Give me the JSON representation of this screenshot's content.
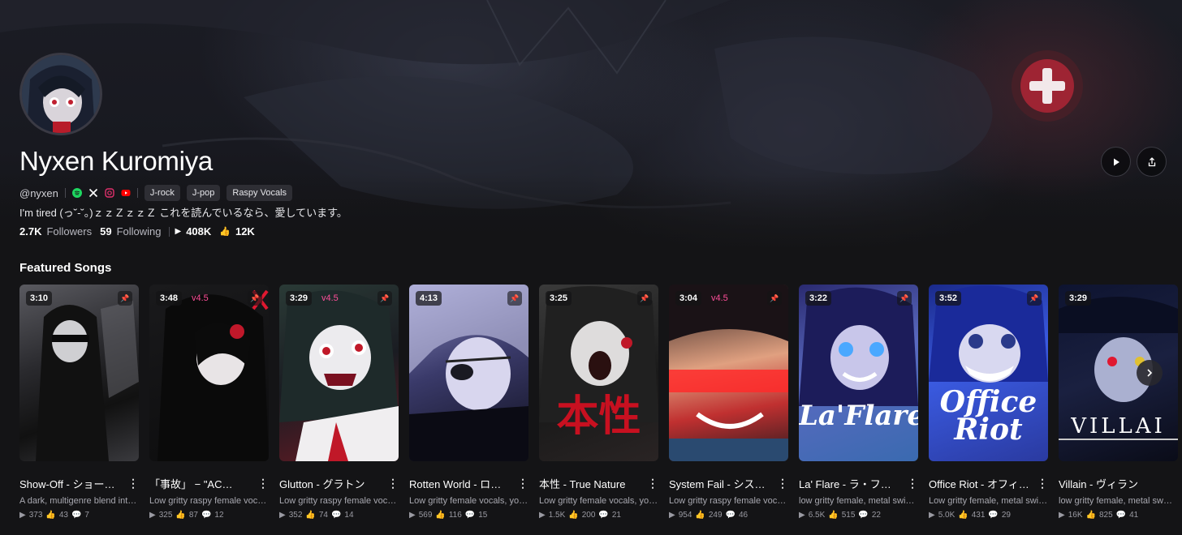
{
  "profile": {
    "name": "Nyxen Kuromiya",
    "handle": "@nyxen",
    "tags": [
      "J-rock",
      "J-pop",
      "Raspy Vocals"
    ],
    "bio": "I'm tired (っ˘-˘。)ｚｚＺｚｚＺ これを読んでいるなら、愛しています。",
    "followers_count": "2.7K",
    "followers_label": "Followers",
    "following_count": "59",
    "following_label": "Following",
    "plays": "408K",
    "likes": "12K",
    "socials": [
      "spotify-icon",
      "x-icon",
      "instagram-icon",
      "youtube-icon"
    ]
  },
  "featured": {
    "title": "Featured Songs",
    "songs": [
      {
        "duration": "3:10",
        "version": "",
        "title": "Show-Off - ショー…",
        "desc": "A dark, multigenre blend int…",
        "plays": "373",
        "likes": "43",
        "comments": "7"
      },
      {
        "duration": "3:48",
        "version": "v4.5",
        "title": "「事故」 − \"AC…",
        "desc": "Low gritty raspy female voc…",
        "plays": "325",
        "likes": "87",
        "comments": "12"
      },
      {
        "duration": "3:29",
        "version": "v4.5",
        "title": "Glutton - グラトン",
        "desc": "Low gritty raspy female voc…",
        "plays": "352",
        "likes": "74",
        "comments": "14"
      },
      {
        "duration": "4:13",
        "version": "",
        "title": "Rotten World - ロッ…",
        "desc": "Low gritty female vocals, yo…",
        "plays": "569",
        "likes": "116",
        "comments": "15"
      },
      {
        "duration": "3:25",
        "version": "",
        "title": "本性 - True Nature",
        "desc": "Low gritty female vocals, yo…",
        "plays": "1.5K",
        "likes": "200",
        "comments": "21"
      },
      {
        "duration": "3:04",
        "version": "v4.5",
        "title": "System Fail - シス…",
        "desc": "Low gritty raspy female voc…",
        "plays": "954",
        "likes": "249",
        "comments": "46"
      },
      {
        "duration": "3:22",
        "version": "",
        "title": "La' Flare - ラ・フレ…",
        "desc": "low gritty female, metal swi…",
        "plays": "6.5K",
        "likes": "515",
        "comments": "22"
      },
      {
        "duration": "3:52",
        "version": "",
        "title": "Office Riot - オフィ…",
        "desc": "Low gritty female, metal swi…",
        "plays": "5.0K",
        "likes": "431",
        "comments": "29"
      },
      {
        "duration": "3:29",
        "version": "",
        "title": "Villain - ヴィラン",
        "desc": "low gritty female, metal sw…",
        "plays": "16K",
        "likes": "825",
        "comments": "41"
      }
    ]
  },
  "cover_texts": {
    "s4": "本性",
    "s6": "La'Flare",
    "s7a": "Office",
    "s7b": "Riot",
    "s8": "VILLAI"
  },
  "colors": {
    "version_accent": "#ff4f9a",
    "background": "#141416"
  }
}
